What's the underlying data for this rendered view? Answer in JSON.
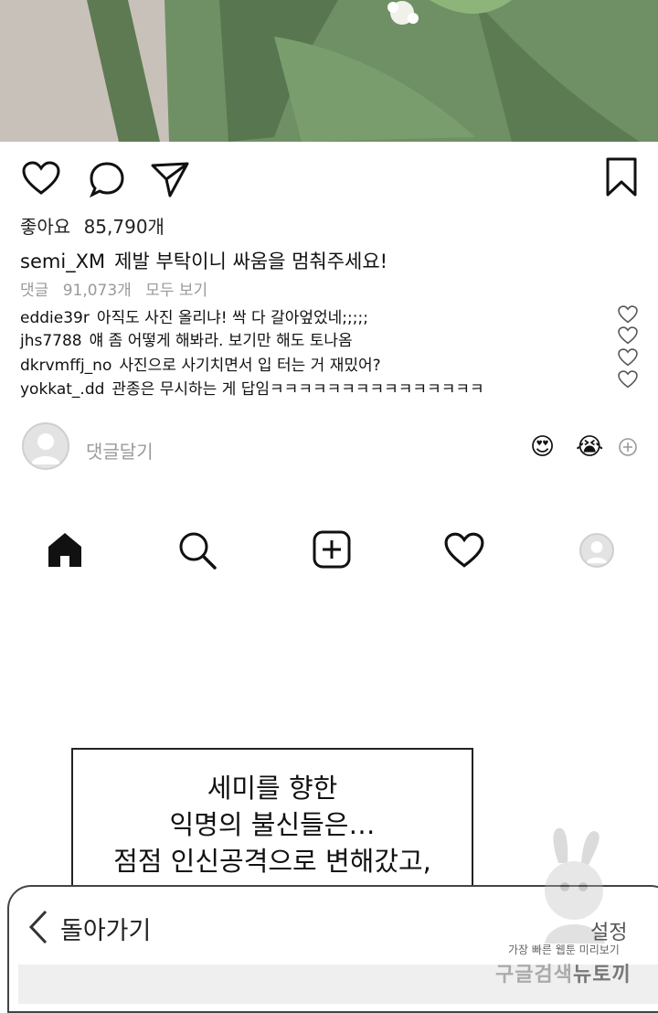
{
  "post": {
    "likes_label": "좋아요",
    "likes_count": "85,790개",
    "caption_user": "semi_XM",
    "caption_text": "제발 부탁이니 싸움을 멈춰주세요!",
    "comments_label": "댓글",
    "comments_count": "91,073개",
    "view_all": "모두 보기",
    "comments": [
      {
        "user": "eddie39r",
        "text": "아직도 사진 올리냐! 싹 다 갈아엎었네;;;;;"
      },
      {
        "user": "jhs7788",
        "text": "얘 좀 어떻게 해봐라. 보기만 해도 토나옴"
      },
      {
        "user": "dkrvmffj_no",
        "text": "사진으로 사기치면서 입 터는 거 재밌어?"
      },
      {
        "user": "yokkat_.dd",
        "text": "관종은 무시하는 게 답임ㅋㅋㅋㅋㅋㅋㅋㅋㅋㅋㅋㅋㅋㅋㅋ"
      }
    ],
    "add_comment_placeholder": "댓글달기",
    "quick_emojis": [
      "😍",
      "😭"
    ]
  },
  "icons": {
    "actions": [
      "heart-icon",
      "comment-icon",
      "share-icon",
      "bookmark-icon"
    ],
    "nav": [
      "home-icon",
      "search-icon",
      "add-post-icon",
      "activity-heart-icon",
      "profile-icon"
    ]
  },
  "narration": {
    "lines": [
      "세미를 향한",
      "익명의 불신들은…",
      "점점 인신공격으로 변해갔고,"
    ]
  },
  "reader_bar": {
    "back_label": "돌아가기",
    "settings_label": "설정"
  },
  "watermark": {
    "small": "가장 빠른 웹툰 미리보기",
    "big_a": "구글검색",
    "big_b": "뉴토끼"
  }
}
